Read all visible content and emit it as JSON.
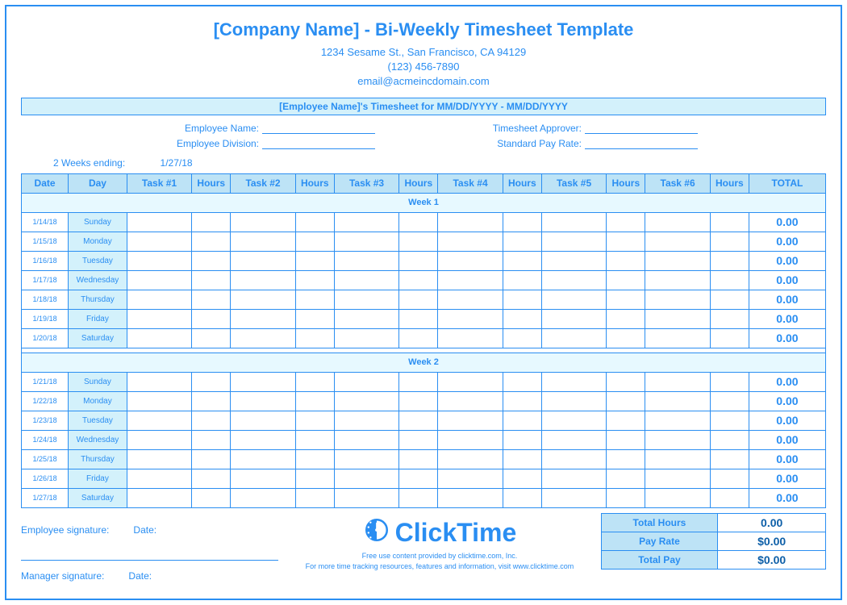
{
  "header": {
    "title": "[Company Name] - Bi-Weekly Timesheet Template",
    "address": "1234 Sesame St.,  San Francisco, CA 94129",
    "phone": "(123) 456-7890",
    "email": "email@acmeincdomain.com"
  },
  "banner": "[Employee Name]'s Timesheet for MM/DD/YYYY - MM/DD/YYYY",
  "meta": {
    "employee_name_label": "Employee Name:",
    "employee_name": "",
    "employee_division_label": "Employee Division:",
    "employee_division": "",
    "approver_label": "Timesheet Approver:",
    "approver": "",
    "pay_rate_label": "Standard Pay Rate:",
    "pay_rate": ""
  },
  "ending_label": "2 Weeks ending:",
  "ending_value": "1/27/18",
  "columns": {
    "date": "Date",
    "day": "Day",
    "task1": "Task #1",
    "hours1": "Hours",
    "task2": "Task #2",
    "hours2": "Hours",
    "task3": "Task #3",
    "hours3": "Hours",
    "task4": "Task #4",
    "hours4": "Hours",
    "task5": "Task #5",
    "hours5": "Hours",
    "task6": "Task #6",
    "hours6": "Hours",
    "total": "TOTAL"
  },
  "week1_label": "Week 1",
  "week2_label": "Week 2",
  "week1": [
    {
      "date": "1/14/18",
      "day": "Sunday",
      "total": "0.00"
    },
    {
      "date": "1/15/18",
      "day": "Monday",
      "total": "0.00"
    },
    {
      "date": "1/16/18",
      "day": "Tuesday",
      "total": "0.00"
    },
    {
      "date": "1/17/18",
      "day": "Wednesday",
      "total": "0.00"
    },
    {
      "date": "1/18/18",
      "day": "Thursday",
      "total": "0.00"
    },
    {
      "date": "1/19/18",
      "day": "Friday",
      "total": "0.00"
    },
    {
      "date": "1/20/18",
      "day": "Saturday",
      "total": "0.00"
    }
  ],
  "week2": [
    {
      "date": "1/21/18",
      "day": "Sunday",
      "total": "0.00"
    },
    {
      "date": "1/22/18",
      "day": "Monday",
      "total": "0.00"
    },
    {
      "date": "1/23/18",
      "day": "Tuesday",
      "total": "0.00"
    },
    {
      "date": "1/24/18",
      "day": "Wednesday",
      "total": "0.00"
    },
    {
      "date": "1/25/18",
      "day": "Thursday",
      "total": "0.00"
    },
    {
      "date": "1/26/18",
      "day": "Friday",
      "total": "0.00"
    },
    {
      "date": "1/27/18",
      "day": "Saturday",
      "total": "0.00"
    }
  ],
  "summary": {
    "total_hours_label": "Total Hours",
    "total_hours": "0.00",
    "pay_rate_label": "Pay Rate",
    "pay_rate": "$0.00",
    "total_pay_label": "Total Pay",
    "total_pay": "$0.00"
  },
  "signatures": {
    "employee_label": "Employee signature:",
    "manager_label": "Manager signature:",
    "date_label": "Date:"
  },
  "brand": {
    "name": "ClickTime",
    "line1": "Free use content provided by clicktime.com, Inc.",
    "line2": "For more time tracking resources, features and information, visit www.clicktime.com"
  }
}
